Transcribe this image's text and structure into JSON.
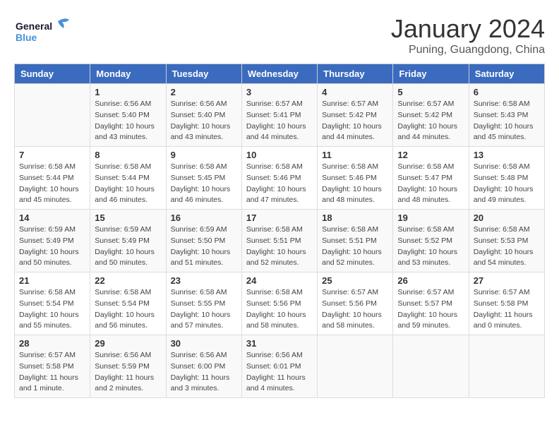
{
  "header": {
    "logo_general": "General",
    "logo_blue": "Blue",
    "month_title": "January 2024",
    "location": "Puning, Guangdong, China"
  },
  "weekdays": [
    "Sunday",
    "Monday",
    "Tuesday",
    "Wednesday",
    "Thursday",
    "Friday",
    "Saturday"
  ],
  "weeks": [
    [
      {
        "day": "",
        "info": ""
      },
      {
        "day": "1",
        "info": "Sunrise: 6:56 AM\nSunset: 5:40 PM\nDaylight: 10 hours\nand 43 minutes."
      },
      {
        "day": "2",
        "info": "Sunrise: 6:56 AM\nSunset: 5:40 PM\nDaylight: 10 hours\nand 43 minutes."
      },
      {
        "day": "3",
        "info": "Sunrise: 6:57 AM\nSunset: 5:41 PM\nDaylight: 10 hours\nand 44 minutes."
      },
      {
        "day": "4",
        "info": "Sunrise: 6:57 AM\nSunset: 5:42 PM\nDaylight: 10 hours\nand 44 minutes."
      },
      {
        "day": "5",
        "info": "Sunrise: 6:57 AM\nSunset: 5:42 PM\nDaylight: 10 hours\nand 44 minutes."
      },
      {
        "day": "6",
        "info": "Sunrise: 6:58 AM\nSunset: 5:43 PM\nDaylight: 10 hours\nand 45 minutes."
      }
    ],
    [
      {
        "day": "7",
        "info": "Sunrise: 6:58 AM\nSunset: 5:44 PM\nDaylight: 10 hours\nand 45 minutes."
      },
      {
        "day": "8",
        "info": "Sunrise: 6:58 AM\nSunset: 5:44 PM\nDaylight: 10 hours\nand 46 minutes."
      },
      {
        "day": "9",
        "info": "Sunrise: 6:58 AM\nSunset: 5:45 PM\nDaylight: 10 hours\nand 46 minutes."
      },
      {
        "day": "10",
        "info": "Sunrise: 6:58 AM\nSunset: 5:46 PM\nDaylight: 10 hours\nand 47 minutes."
      },
      {
        "day": "11",
        "info": "Sunrise: 6:58 AM\nSunset: 5:46 PM\nDaylight: 10 hours\nand 48 minutes."
      },
      {
        "day": "12",
        "info": "Sunrise: 6:58 AM\nSunset: 5:47 PM\nDaylight: 10 hours\nand 48 minutes."
      },
      {
        "day": "13",
        "info": "Sunrise: 6:58 AM\nSunset: 5:48 PM\nDaylight: 10 hours\nand 49 minutes."
      }
    ],
    [
      {
        "day": "14",
        "info": "Sunrise: 6:59 AM\nSunset: 5:49 PM\nDaylight: 10 hours\nand 50 minutes."
      },
      {
        "day": "15",
        "info": "Sunrise: 6:59 AM\nSunset: 5:49 PM\nDaylight: 10 hours\nand 50 minutes."
      },
      {
        "day": "16",
        "info": "Sunrise: 6:59 AM\nSunset: 5:50 PM\nDaylight: 10 hours\nand 51 minutes."
      },
      {
        "day": "17",
        "info": "Sunrise: 6:58 AM\nSunset: 5:51 PM\nDaylight: 10 hours\nand 52 minutes."
      },
      {
        "day": "18",
        "info": "Sunrise: 6:58 AM\nSunset: 5:51 PM\nDaylight: 10 hours\nand 52 minutes."
      },
      {
        "day": "19",
        "info": "Sunrise: 6:58 AM\nSunset: 5:52 PM\nDaylight: 10 hours\nand 53 minutes."
      },
      {
        "day": "20",
        "info": "Sunrise: 6:58 AM\nSunset: 5:53 PM\nDaylight: 10 hours\nand 54 minutes."
      }
    ],
    [
      {
        "day": "21",
        "info": "Sunrise: 6:58 AM\nSunset: 5:54 PM\nDaylight: 10 hours\nand 55 minutes."
      },
      {
        "day": "22",
        "info": "Sunrise: 6:58 AM\nSunset: 5:54 PM\nDaylight: 10 hours\nand 56 minutes."
      },
      {
        "day": "23",
        "info": "Sunrise: 6:58 AM\nSunset: 5:55 PM\nDaylight: 10 hours\nand 57 minutes."
      },
      {
        "day": "24",
        "info": "Sunrise: 6:58 AM\nSunset: 5:56 PM\nDaylight: 10 hours\nand 58 minutes."
      },
      {
        "day": "25",
        "info": "Sunrise: 6:57 AM\nSunset: 5:56 PM\nDaylight: 10 hours\nand 58 minutes."
      },
      {
        "day": "26",
        "info": "Sunrise: 6:57 AM\nSunset: 5:57 PM\nDaylight: 10 hours\nand 59 minutes."
      },
      {
        "day": "27",
        "info": "Sunrise: 6:57 AM\nSunset: 5:58 PM\nDaylight: 11 hours\nand 0 minutes."
      }
    ],
    [
      {
        "day": "28",
        "info": "Sunrise: 6:57 AM\nSunset: 5:58 PM\nDaylight: 11 hours\nand 1 minute."
      },
      {
        "day": "29",
        "info": "Sunrise: 6:56 AM\nSunset: 5:59 PM\nDaylight: 11 hours\nand 2 minutes."
      },
      {
        "day": "30",
        "info": "Sunrise: 6:56 AM\nSunset: 6:00 PM\nDaylight: 11 hours\nand 3 minutes."
      },
      {
        "day": "31",
        "info": "Sunrise: 6:56 AM\nSunset: 6:01 PM\nDaylight: 11 hours\nand 4 minutes."
      },
      {
        "day": "",
        "info": ""
      },
      {
        "day": "",
        "info": ""
      },
      {
        "day": "",
        "info": ""
      }
    ]
  ]
}
